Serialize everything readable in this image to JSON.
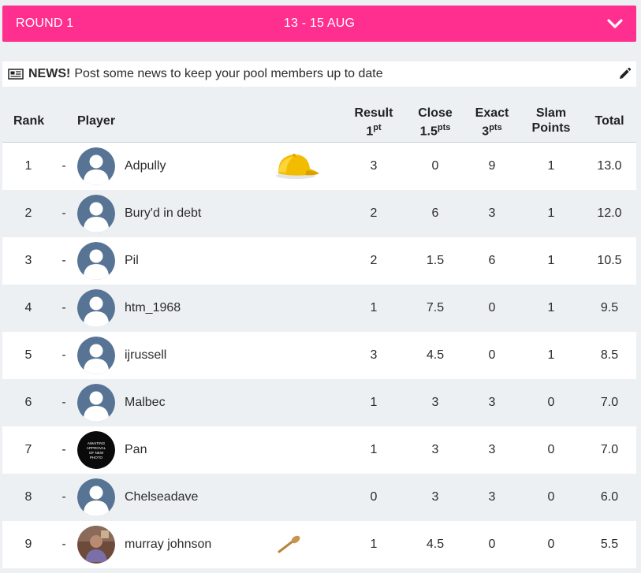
{
  "round": {
    "label": "ROUND 1",
    "dates": "13 - 15 AUG",
    "toggle_icon": "chevron-down-icon",
    "color": "#ff2f8f"
  },
  "news": {
    "icon": "newspaper-icon",
    "strong": "NEWS!",
    "text": "Post some news to keep your pool members up to date",
    "edit_icon": "pencil-icon"
  },
  "table": {
    "headers": {
      "rank": "Rank",
      "player": "Player",
      "result_top": "Result",
      "result_val": "1",
      "result_unit": "pt",
      "close_top": "Close",
      "close_val": "1.5",
      "close_unit": "pts",
      "exact_top": "Exact",
      "exact_val": "3",
      "exact_unit": "pts",
      "slam_top": "Slam",
      "slam_bottom": "Points",
      "total": "Total"
    },
    "rows": [
      {
        "rank": "1",
        "dash": "-",
        "avatar": "default",
        "name": "Adpully",
        "badge": "yellow-cap-icon",
        "result": "3",
        "close": "0",
        "exact": "9",
        "slam": "1",
        "total": "13.0"
      },
      {
        "rank": "2",
        "dash": "-",
        "avatar": "default",
        "name": "Bury'd in debt",
        "badge": "",
        "result": "2",
        "close": "6",
        "exact": "3",
        "slam": "1",
        "total": "12.0"
      },
      {
        "rank": "3",
        "dash": "-",
        "avatar": "default",
        "name": "Pil",
        "badge": "",
        "result": "2",
        "close": "1.5",
        "exact": "6",
        "slam": "1",
        "total": "10.5"
      },
      {
        "rank": "4",
        "dash": "-",
        "avatar": "default",
        "name": "htm_1968",
        "badge": "",
        "result": "1",
        "close": "7.5",
        "exact": "0",
        "slam": "1",
        "total": "9.5"
      },
      {
        "rank": "5",
        "dash": "-",
        "avatar": "default",
        "name": "ijrussell",
        "badge": "",
        "result": "3",
        "close": "4.5",
        "exact": "0",
        "slam": "1",
        "total": "8.5"
      },
      {
        "rank": "6",
        "dash": "-",
        "avatar": "default",
        "name": "Malbec",
        "badge": "",
        "result": "1",
        "close": "3",
        "exact": "3",
        "slam": "0",
        "total": "7.0"
      },
      {
        "rank": "7",
        "dash": "-",
        "avatar": "awaiting",
        "avatar_text": [
          "AWAITING",
          "APPROVAL",
          "OF NEW",
          "PHOTO"
        ],
        "name": "Pan",
        "badge": "",
        "result": "1",
        "close": "3",
        "exact": "3",
        "slam": "0",
        "total": "7.0"
      },
      {
        "rank": "8",
        "dash": "-",
        "avatar": "default",
        "name": "Chelseadave",
        "badge": "",
        "result": "0",
        "close": "3",
        "exact": "3",
        "slam": "0",
        "total": "6.0"
      },
      {
        "rank": "9",
        "dash": "-",
        "avatar": "photo",
        "name": "murray johnson",
        "badge": "wooden-spoon-icon",
        "result": "1",
        "close": "4.5",
        "exact": "0",
        "slam": "0",
        "total": "5.5"
      }
    ]
  }
}
